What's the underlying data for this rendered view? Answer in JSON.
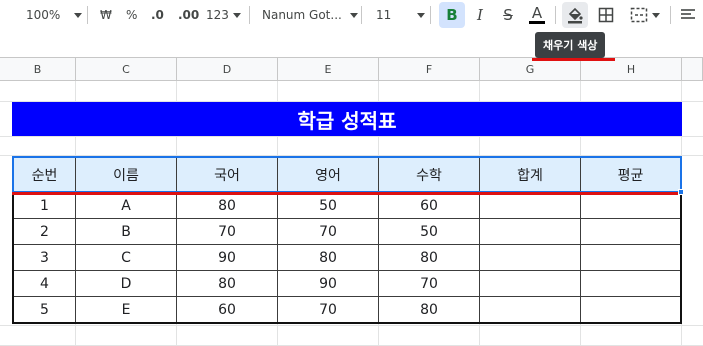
{
  "toolbar": {
    "zoom": "100%",
    "currency": "₩",
    "percent": "%",
    "decrease_decimal": ".0",
    "increase_decimal": ".00",
    "number_format": "123",
    "font_name": "Nanum Got...",
    "font_size": "11",
    "bold": "B",
    "italic": "I",
    "strikethrough": "S",
    "text_color": "A"
  },
  "tooltip": "채우기 색상",
  "columns": [
    "B",
    "C",
    "D",
    "E",
    "F",
    "G",
    "H"
  ],
  "sheet": {
    "title": "학급 성적표",
    "headers": [
      "순번",
      "이름",
      "국어",
      "영어",
      "수학",
      "합계",
      "평균"
    ],
    "rows": [
      [
        "1",
        "A",
        "80",
        "50",
        "60",
        "",
        ""
      ],
      [
        "2",
        "B",
        "70",
        "70",
        "50",
        "",
        ""
      ],
      [
        "3",
        "C",
        "90",
        "80",
        "80",
        "",
        ""
      ],
      [
        "4",
        "D",
        "80",
        "90",
        "70",
        "",
        ""
      ],
      [
        "5",
        "E",
        "60",
        "70",
        "80",
        "",
        ""
      ]
    ]
  },
  "colors": {
    "title_bg": "#0000ff",
    "header_bg": "#ddeefd",
    "highlight_line": "#dd1111",
    "selection": "#1a73e8"
  }
}
